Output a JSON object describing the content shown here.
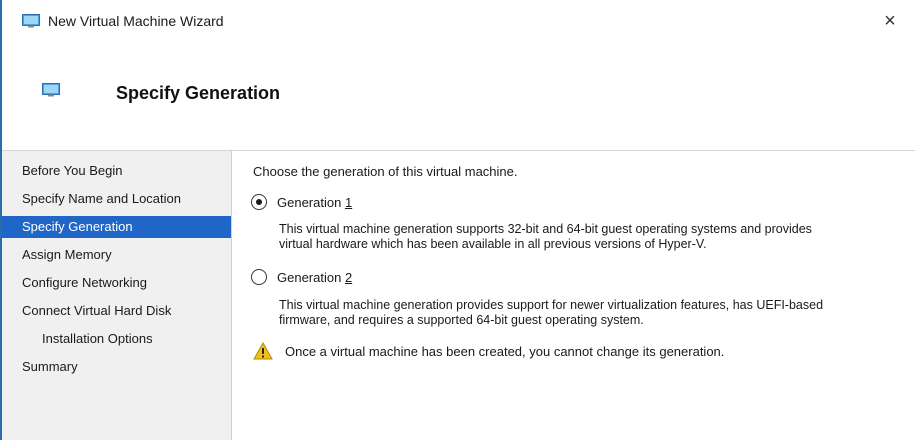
{
  "window": {
    "title": "New Virtual Machine Wizard",
    "close_glyph": "×"
  },
  "header": {
    "title": "Specify Generation"
  },
  "nav": {
    "items": [
      {
        "label": "Before You Begin",
        "selected": false
      },
      {
        "label": "Specify Name and Location",
        "selected": false
      },
      {
        "label": "Specify Generation",
        "selected": true
      },
      {
        "label": "Assign Memory",
        "selected": false
      },
      {
        "label": "Configure Networking",
        "selected": false
      },
      {
        "label": "Connect Virtual Hard Disk",
        "selected": false
      },
      {
        "label": "Installation Options",
        "selected": false
      },
      {
        "label": "Summary",
        "selected": false
      }
    ]
  },
  "content": {
    "intro": "Choose the generation of this virtual machine.",
    "gen1": {
      "label_prefix": "Generation ",
      "label_key": "1",
      "checked": true,
      "desc_line1": "This virtual machine generation supports 32-bit and 64-bit guest operating systems and provides",
      "desc_line2": "virtual hardware which has been available in all previous versions of Hyper-V."
    },
    "gen2": {
      "label_prefix": "Generation ",
      "label_key": "2",
      "checked": false,
      "desc_line1": "This virtual machine generation provides support for newer virtualization features, has UEFI-based",
      "desc_line2": "firmware, and requires a supported 64-bit guest operating system."
    },
    "warning": "Once a virtual machine has been created, you cannot change its generation."
  },
  "colors": {
    "selection": "#1f66c6",
    "nav_background": "#f0f0f0",
    "warning_yellow": "#f2c01e"
  },
  "icons": {
    "title": "vm-monitor-icon",
    "header": "vm-monitor-icon",
    "warning": "warning-triangle-icon"
  }
}
